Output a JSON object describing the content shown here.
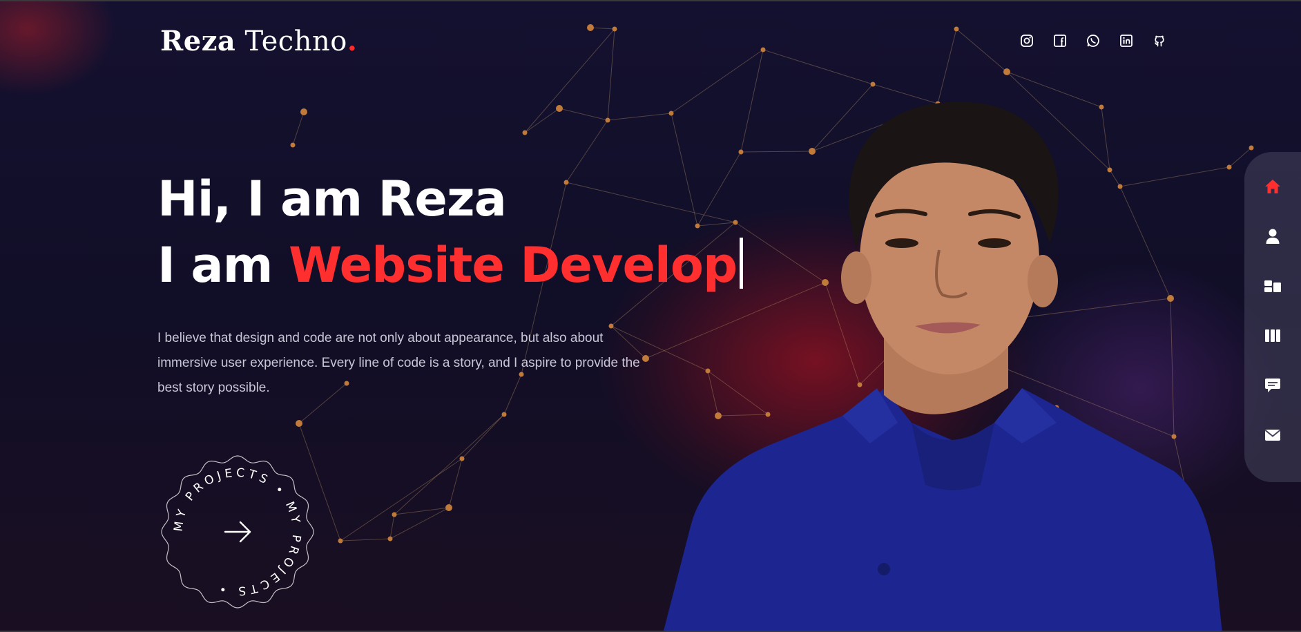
{
  "brand": {
    "name_bold": "Reza",
    "name_regular": "Techno",
    "dot": "."
  },
  "social": [
    {
      "icon": "instagram-icon"
    },
    {
      "icon": "facebook-icon"
    },
    {
      "icon": "whatsapp-icon"
    },
    {
      "icon": "linkedin-icon"
    },
    {
      "icon": "github-icon"
    }
  ],
  "hero": {
    "line1": "Hi, I am Reza",
    "line2_prefix": "I am ",
    "line2_accent": "Website Develop",
    "description": "I believe that design and code are not only about appearance, but also about immersive user experience. Every line of code is a story, and I aspire to provide the best story possible."
  },
  "badge": {
    "text": "MY PROJECTS • MY PROJECTS •"
  },
  "dock": [
    {
      "icon": "home-icon",
      "active": true
    },
    {
      "icon": "user-icon",
      "active": false
    },
    {
      "icon": "services-icon",
      "active": false
    },
    {
      "icon": "portfolio-icon",
      "active": false
    },
    {
      "icon": "chat-icon",
      "active": false
    },
    {
      "icon": "mail-icon",
      "active": false
    }
  ],
  "colors": {
    "accent": "#ff2f2f",
    "background": "#110e27",
    "text_muted": "#c9c6d6",
    "shirt": "#1c2590"
  }
}
